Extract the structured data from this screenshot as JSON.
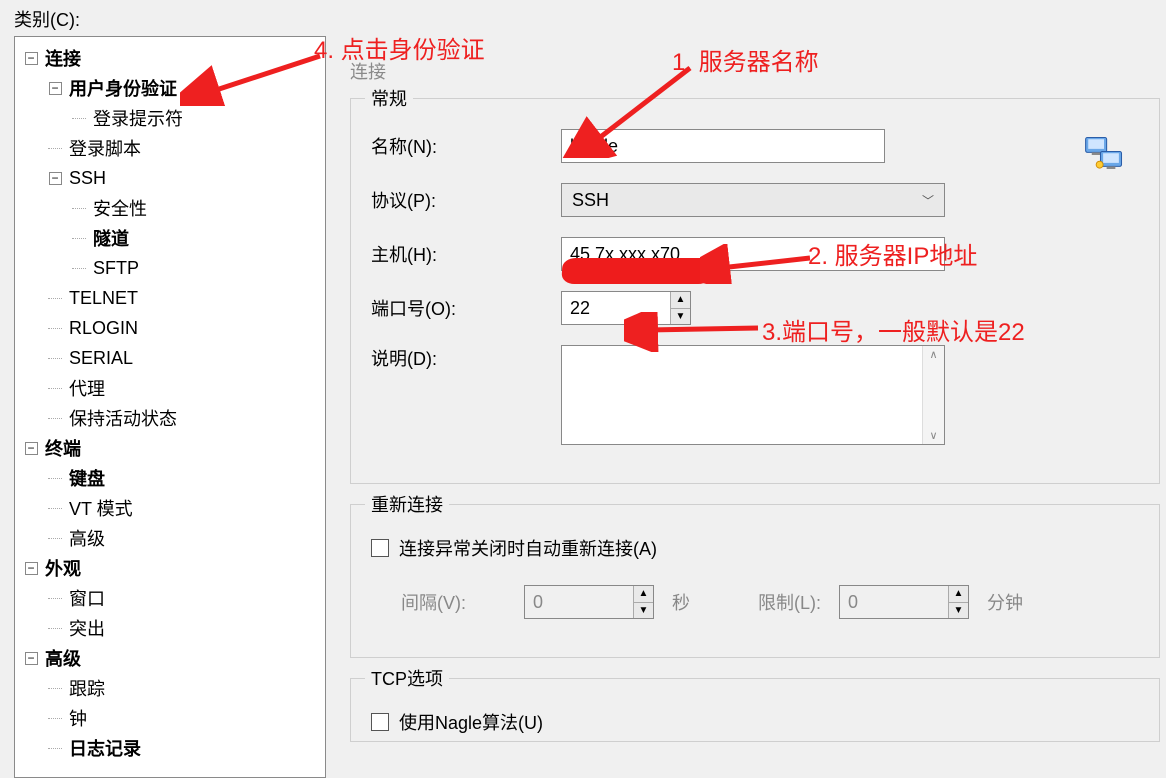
{
  "category_label": "类别(C):",
  "tree": {
    "connection": "连接",
    "user_auth": "用户身份验证",
    "login_prompt": "登录提示符",
    "login_script": "登录脚本",
    "ssh": "SSH",
    "security": "安全性",
    "tunnel": "隧道",
    "sftp": "SFTP",
    "telnet": "TELNET",
    "rlogin": "RLOGIN",
    "serial": "SERIAL",
    "proxy": "代理",
    "keepalive": "保持活动状态",
    "terminal": "终端",
    "keyboard": "键盘",
    "vt_mode": "VT 模式",
    "advanced_t": "高级",
    "appearance": "外观",
    "window": "窗口",
    "highlight": "突出",
    "advanced": "高级",
    "trace": "跟踪",
    "clock": "钟",
    "log": "日志记录"
  },
  "panel_title": "连接",
  "groups": {
    "general": "常规",
    "reconnect": "重新连接",
    "tcp": "TCP选项"
  },
  "labels": {
    "name": "名称(N):",
    "protocol": "协议(P):",
    "host": "主机(H):",
    "port": "端口号(O):",
    "desc": "说明(D):",
    "interval": "间隔(V):",
    "limit": "限制(L):",
    "sec": "秒",
    "min": "分钟"
  },
  "values": {
    "name": "linode",
    "protocol": "SSH",
    "host": "45.7x.xxx.x70",
    "port": "22",
    "interval": "0",
    "limit": "0"
  },
  "checkboxes": {
    "auto_reconnect": "连接异常关闭时自动重新连接(A)",
    "nagle": "使用Nagle算法(U)"
  },
  "annotations": {
    "a1": "1. 服务器名称",
    "a2": "2. 服务器IP地址",
    "a3": "3.端口号，一般默认是22",
    "a4": "4. 点击身份验证"
  }
}
